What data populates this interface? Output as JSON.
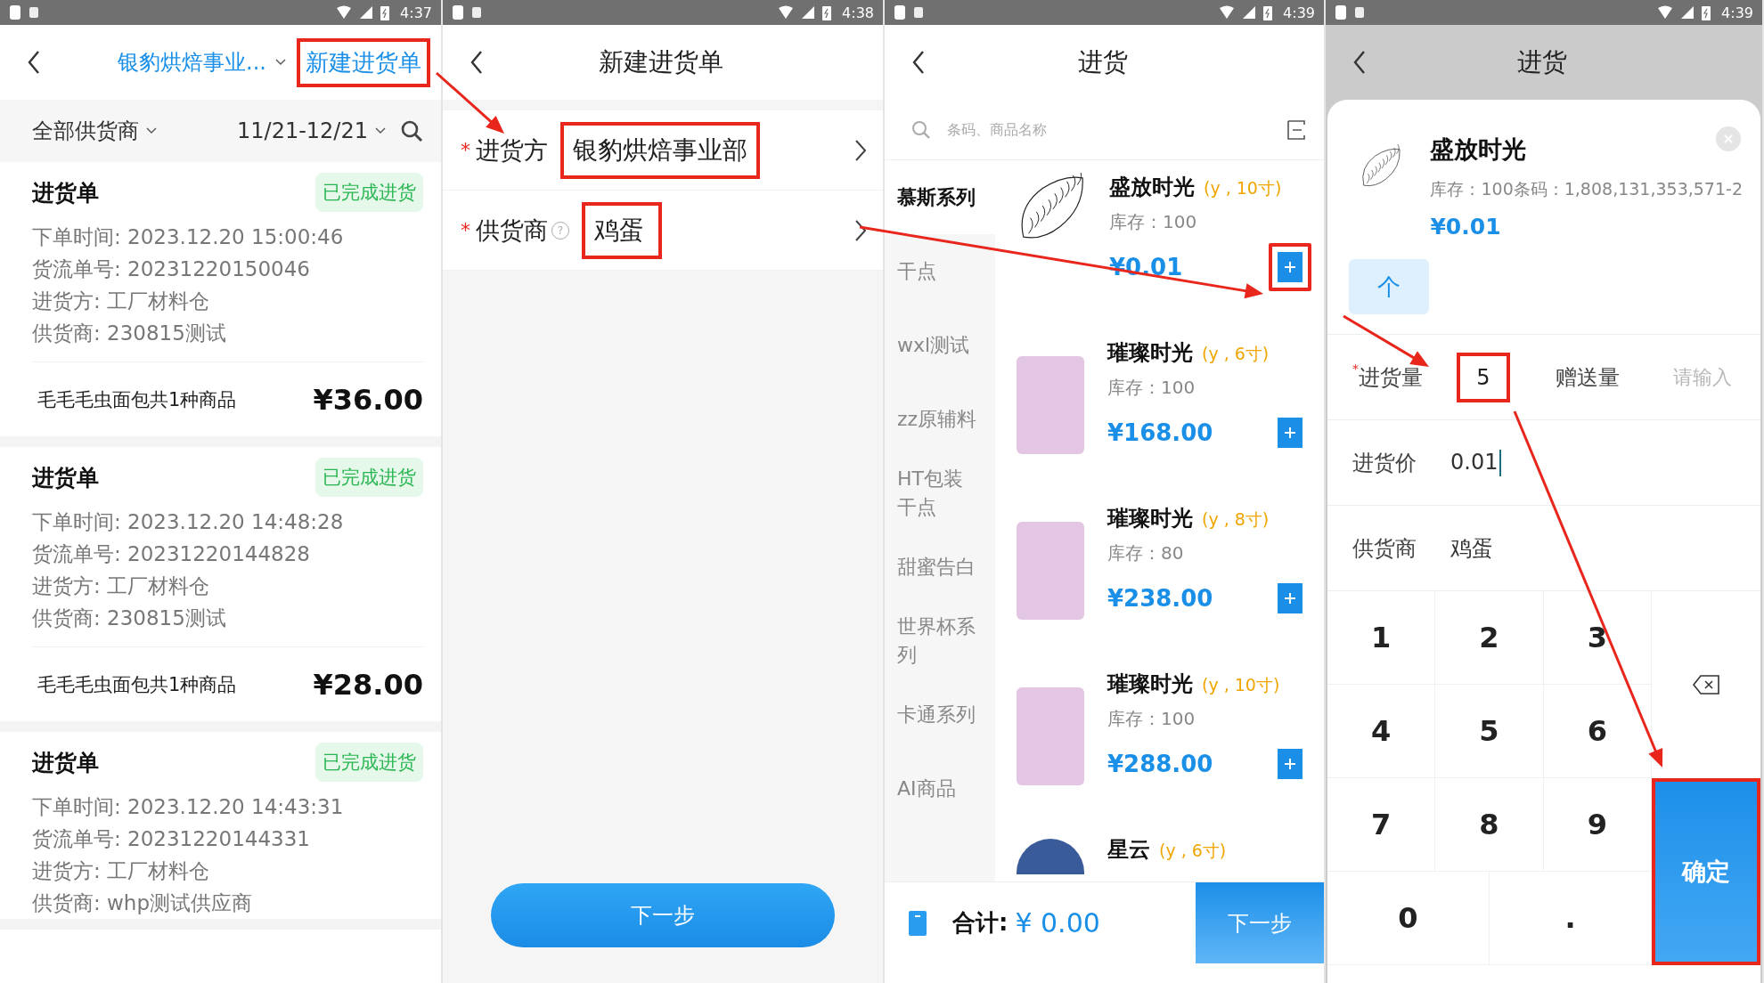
{
  "order_list": {
    "status_time": "4:37",
    "company": "银豹烘焙事业...",
    "new_button": {
      "label": "新建进货单",
      "highlighted": true
    },
    "filter_supplier": "全部供货商",
    "filter_date": "11/21-12/21",
    "orders": [
      {
        "title": "进货单",
        "status": "已完成进货",
        "lines": [
          "下单时间: 2023.12.20 15:00:46",
          "货流单号: 20231220150046",
          "进货方: 工厂材料仓",
          "供货商: 230815测试"
        ],
        "summary": "毛毛毛虫面包共1种商品",
        "amount": "¥36.00"
      },
      {
        "title": "进货单",
        "status": "已完成进货",
        "lines": [
          "下单时间: 2023.12.20 14:48:28",
          "货流单号: 20231220144828",
          "进货方: 工厂材料仓",
          "供货商: 230815测试"
        ],
        "summary": "毛毛毛虫面包共1种商品",
        "amount": "¥28.00"
      },
      {
        "title": "进货单",
        "status": "已完成进货",
        "lines": [
          "下单时间: 2023.12.20 14:43:31",
          "货流单号: 20231220144331",
          "进货方: 工厂材料仓",
          "供货商: whp测试供应商"
        ]
      }
    ]
  },
  "new_order": {
    "status_time": "4:38",
    "title": "新建进货单",
    "fields": [
      {
        "mark": "*",
        "label": "进货方",
        "value": "银豹烘焙事业部",
        "highlighted": true
      },
      {
        "mark": "*",
        "label": "供货商",
        "help": "?",
        "value": "鸡蛋",
        "highlighted": true
      }
    ],
    "next_button": "下一步"
  },
  "goods": {
    "status_time": "4:39",
    "title": "进货",
    "search": {
      "placeholder": "条码、商品名称"
    },
    "categories": [
      {
        "label": "慕斯系列",
        "selected": true
      },
      {
        "label": "干点",
        "selected": false
      },
      {
        "label": "wxl测试",
        "selected": false
      },
      {
        "label": "zz原辅料",
        "selected": false
      },
      {
        "label": "HT包装干点",
        "selected": false
      },
      {
        "label": "甜蜜告白",
        "selected": false
      },
      {
        "label": "世界杯系列",
        "selected": false
      },
      {
        "label": "卡通系列",
        "selected": false
      },
      {
        "label": "AI商品",
        "selected": false
      }
    ],
    "products": [
      {
        "name": "盛放时光",
        "spec": "(y , 10寸)",
        "stock": "库存：100",
        "price": "¥0.01",
        "kind": "sketch",
        "highlighted": true
      },
      {
        "name": "璀璨时光",
        "spec": "(y , 6寸)",
        "stock": "库存：100",
        "price": "¥168.00",
        "kind": "cake",
        "highlighted": false
      },
      {
        "name": "璀璨时光",
        "spec": "(y , 8寸)",
        "stock": "库存：80",
        "price": "¥238.00",
        "kind": "cake",
        "highlighted": false
      },
      {
        "name": "璀璨时光",
        "spec": "(y , 10寸)",
        "stock": "库存：100",
        "price": "¥288.00",
        "kind": "cake",
        "highlighted": false
      },
      {
        "name": "星云",
        "spec": "(y , 6寸)",
        "kind": "dome"
      }
    ],
    "total_label": "合计:",
    "total_value": "¥ 0.00",
    "next_button": "下一步"
  },
  "quantity_sheet": {
    "status_time": "4:39",
    "title": "进货",
    "product": {
      "name": "盛放时光",
      "info": "库存：100条码：1,808,131,353,571-2",
      "price": "¥0.01"
    },
    "unit": "个",
    "quantity": {
      "mark": "*",
      "label": "进货量",
      "value": "5",
      "highlighted": true
    },
    "gift": {
      "label": "赠送量",
      "placeholder": "请输入"
    },
    "rows": [
      {
        "label": "进货价",
        "value": "0.01"
      },
      {
        "label": "供货商",
        "value": "鸡蛋"
      }
    ],
    "keys": [
      "1",
      "2",
      "3",
      "4",
      "5",
      "6",
      "7",
      "8",
      "9",
      "0",
      "."
    ],
    "confirm": {
      "label": "确定",
      "highlighted": true
    }
  }
}
